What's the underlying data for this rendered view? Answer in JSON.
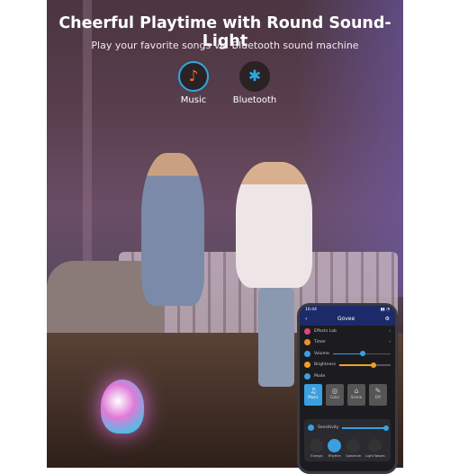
{
  "header": {
    "title": "Cheerful Playtime with Round Sound-Light",
    "subtitle": "Play your favorite songs via Bluetooth sound machine"
  },
  "features": [
    {
      "label": "Music",
      "icon": "music-note-icon"
    },
    {
      "label": "Bluetooth",
      "icon": "bluetooth-icon"
    }
  ],
  "phone": {
    "time": "16:44",
    "app_title": "Govee",
    "items": [
      {
        "label": "Effects Lab",
        "color": "#e0457b"
      },
      {
        "label": "Timer",
        "color": "#f0902a"
      },
      {
        "label": "Volume",
        "color": "#3aa0e0",
        "level": 0.5
      },
      {
        "label": "Brightness",
        "color": "#f0a020",
        "level": 0.65
      },
      {
        "label": "Mode",
        "color": "#3aa0e0"
      }
    ],
    "modes": [
      {
        "label": "Music",
        "active": true
      },
      {
        "label": "Color"
      },
      {
        "label": "Scene"
      },
      {
        "label": "DIY"
      }
    ],
    "sensitivity": {
      "label": "Sensitivity",
      "level": 0.95
    },
    "effects": [
      "Energic",
      "Rhythm",
      "Spectrum",
      "Light Waves"
    ]
  },
  "colors": {
    "accent": "#3aa0e0",
    "phone_header": "#1c2a6a"
  }
}
